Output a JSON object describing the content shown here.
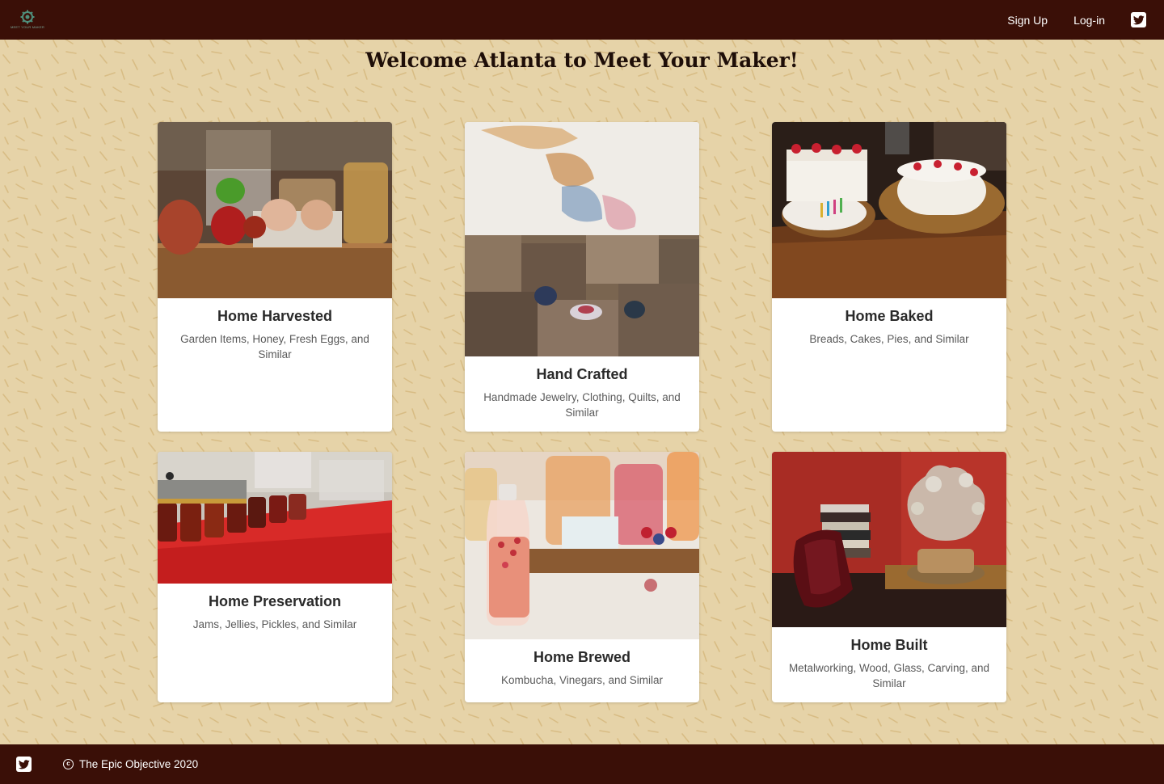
{
  "header": {
    "logo_text": "MEET YOUR MAKER",
    "nav": {
      "signup_label": "Sign Up",
      "login_label": "Log-in"
    }
  },
  "page_title": "Welcome Atlanta to Meet Your Maker!",
  "cards": [
    {
      "title": "Home Harvested",
      "description": "Garden Items, Honey, Fresh Eggs, and Similar"
    },
    {
      "title": "Hand Crafted",
      "description": "Handmade Jewelry, Clothing, Quilts, and Similar"
    },
    {
      "title": "Home Baked",
      "description": "Breads, Cakes, Pies, and Similar"
    },
    {
      "title": "Home Preservation",
      "description": "Jams, Jellies, Pickles, and Similar"
    },
    {
      "title": "Home Brewed",
      "description": "Kombucha, Vinegars, and Similar"
    },
    {
      "title": "Home Built",
      "description": "Metalworking, Wood, Glass, Carving, and Similar"
    }
  ],
  "footer": {
    "copyright_text": "The Epic Objective 2020"
  },
  "colors": {
    "header_bg": "#3a0f07",
    "page_bg": "#e6d3a8",
    "pattern_stroke": "#d9bf88",
    "card_bg": "#ffffff"
  },
  "icons": {
    "brand": "twitter-icon",
    "logo": "gear-leaf-logo-icon",
    "copyright": "copyright-icon"
  }
}
